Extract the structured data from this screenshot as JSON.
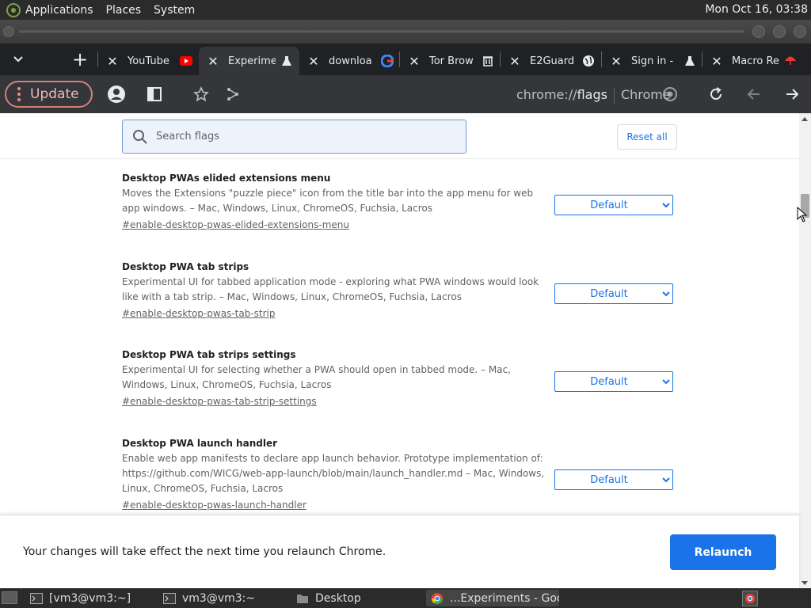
{
  "top_panel": {
    "menus": [
      "Applications",
      "Places",
      "System"
    ],
    "clock": "Mon Oct 16, 03:38"
  },
  "tabs": [
    {
      "title": "YouTube",
      "favicon": "youtube-icon",
      "active": false
    },
    {
      "title": "Experime",
      "favicon": "flask-icon",
      "active": true
    },
    {
      "title": "downloa",
      "favicon": "google-icon",
      "active": false
    },
    {
      "title": "Tor Brow",
      "favicon": "trash-icon",
      "active": false
    },
    {
      "title": "E2Guard",
      "favicon": "globe-icon",
      "active": false
    },
    {
      "title": "Sign in -",
      "favicon": "flask-icon",
      "active": false
    },
    {
      "title": "Macro Re",
      "favicon": "umbrella-icon",
      "active": false
    }
  ],
  "toolbar": {
    "update_label": "Update",
    "url_prefix": "chrome://",
    "url_host": "flags",
    "browser_label": "Chrome"
  },
  "search": {
    "placeholder": "Search flags",
    "reset_label": "Reset all"
  },
  "flags": [
    {
      "name": "Desktop PWAs elided extensions menu",
      "description": "Moves the Extensions \"puzzle piece\" icon from the title bar into the app menu for web app windows. – Mac, Windows, Linux, ChromeOS, Fuchsia, Lacros",
      "id": "#enable-desktop-pwas-elided-extensions-menu",
      "value": "Default"
    },
    {
      "name": "Desktop PWA tab strips",
      "description": "Experimental UI for tabbed application mode - exploring what PWA windows would look like with a tab strip. – Mac, Windows, Linux, ChromeOS, Fuchsia, Lacros",
      "id": "#enable-desktop-pwas-tab-strip",
      "value": "Default"
    },
    {
      "name": "Desktop PWA tab strips settings",
      "description": "Experimental UI for selecting whether a PWA should open in tabbed mode. – Mac, Windows, Linux, ChromeOS, Fuchsia, Lacros",
      "id": "#enable-desktop-pwas-tab-strip-settings",
      "value": "Default"
    },
    {
      "name": "Desktop PWA launch handler",
      "description": "Enable web app manifests to declare app launch behavior. Prototype implementation of: https://github.com/WICG/web-app-launch/blob/main/launch_handler.md – Mac, Windows, Linux, ChromeOS, Fuchsia, Lacros",
      "id": "#enable-desktop-pwas-launch-handler",
      "value": "Default"
    }
  ],
  "relaunch": {
    "message": "Your changes will take effect the next time you relaunch Chrome.",
    "button_label": "Relaunch"
  },
  "taskbar": [
    {
      "label": "[vm3@vm3:~]",
      "icon": "terminal-icon",
      "active": false
    },
    {
      "label": "vm3@vm3:~",
      "icon": "terminal-icon",
      "active": false
    },
    {
      "label": "Desktop",
      "icon": "folder-icon",
      "active": false
    },
    {
      "label": "...Experiments - Goog",
      "icon": "chrome-icon",
      "active": true
    }
  ],
  "colors": {
    "accent_blue": "#1a73e8",
    "update_red": "#f28b82",
    "tabstrip_bg": "#202124",
    "toolbar_bg": "#35363a"
  }
}
